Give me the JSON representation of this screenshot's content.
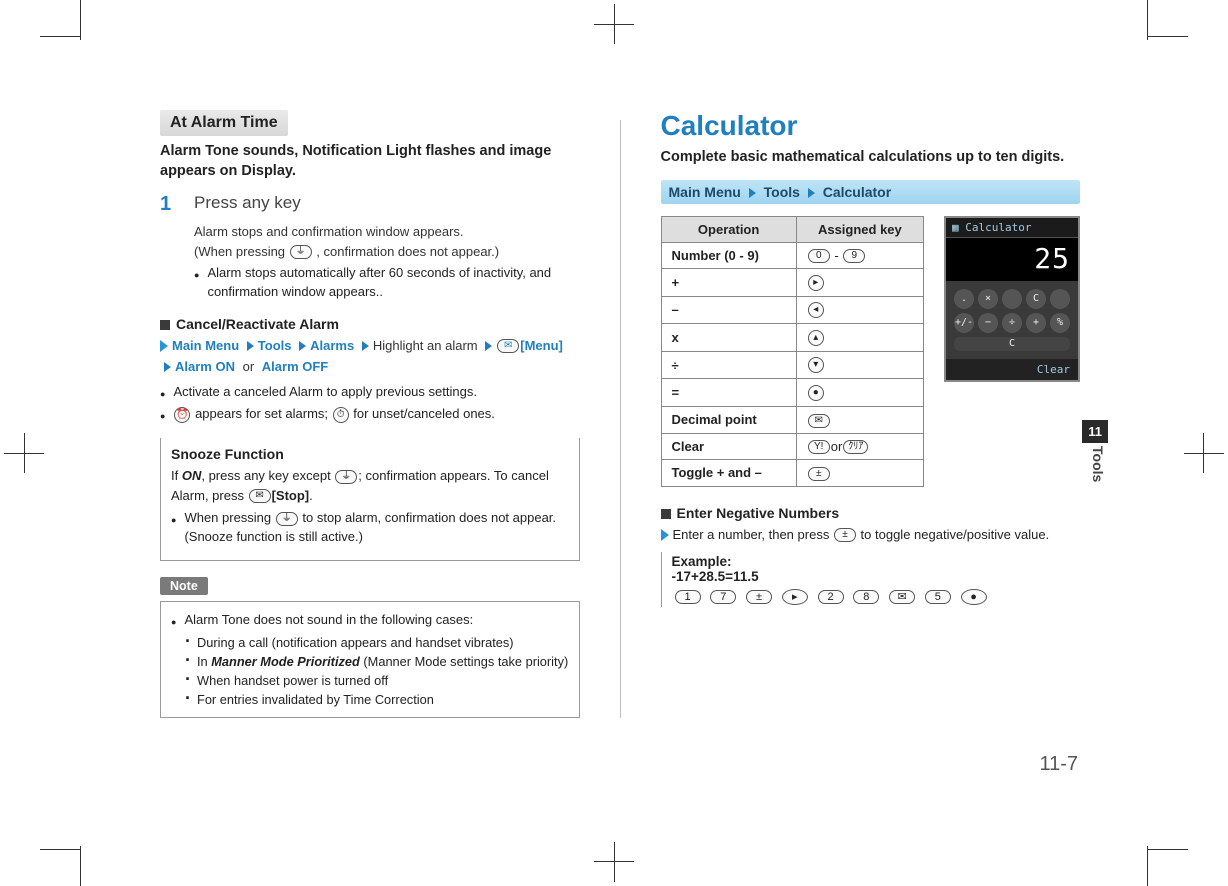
{
  "left": {
    "at_alarm_time": "At Alarm Time",
    "lead": "Alarm Tone sounds, Notification Light flashes and image appears on Display.",
    "step1_num": "1",
    "step1_title": "Press any key",
    "step1_line1": "Alarm stops and confirmation window appears.",
    "step1_line2a": "(When pressing ",
    "step1_line2b": ", confirmation does not appear.)",
    "step1_bullet": "Alarm stops automatically after 60 seconds of inactivity, and confirmation window appears..",
    "cancel_heading": "Cancel/Reactivate Alarm",
    "nav_main": "Main Menu",
    "nav_tools": "Tools",
    "nav_alarms": "Alarms",
    "nav_highlight": "Highlight an alarm",
    "nav_menu": "[Menu]",
    "nav_alarm_on": "Alarm ON",
    "nav_or": "or",
    "nav_alarm_off": "Alarm OFF",
    "cancel_b1": "Activate a canceled Alarm to apply previous settings.",
    "cancel_b2a": "appears for set alarms; ",
    "cancel_b2b": " for unset/canceled ones.",
    "snooze_title": "Snooze Function",
    "snooze_line_a": "If ",
    "snooze_on": "ON",
    "snooze_line_b": ", press any key except ",
    "snooze_line_c": "; confirmation appears. To cancel Alarm, press ",
    "snooze_stop": "[Stop]",
    "snooze_period": ".",
    "snooze_bullet_a": "When pressing ",
    "snooze_bullet_b": " to stop alarm, confirmation does not appear. (Snooze function is still active.)",
    "note_label": "Note",
    "note_intro": "Alarm Tone does not sound in the following cases:",
    "note_i1": "During a call (notification appears and handset vibrates)",
    "note_i2a": "In ",
    "note_i2b": "Manner Mode Prioritized",
    "note_i2c": " (Manner Mode settings take priority)",
    "note_i3": "When handset power is turned off",
    "note_i4": "For entries invalidated by Time Correction"
  },
  "right": {
    "h1": "Calculator",
    "lead": "Complete basic mathematical calculations up to ten digits.",
    "bc_main": "Main Menu",
    "bc_tools": "Tools",
    "bc_calc": "Calculator",
    "th_op": "Operation",
    "th_key": "Assigned key",
    "rows": {
      "r1_op": "Number (0 - 9)",
      "r1_key_a": "0",
      "r1_key_sep": " - ",
      "r1_key_b": "9",
      "r2_op": "+",
      "r3_op": "–",
      "r4_op": "x",
      "r5_op": "÷",
      "r6_op": "=",
      "r7_op": "Decimal point",
      "r8_op": "Clear",
      "r8_or": "or",
      "r9_op": "Toggle + and –"
    },
    "calc_title": "Calculator",
    "calc_display": "25",
    "calc_soft": "Clear",
    "neg_heading": "Enter Negative Numbers",
    "neg_text_a": "Enter a number, then press ",
    "neg_text_b": " to toggle negative/positive value.",
    "ex_label": "Example:",
    "ex_eq": "-17+28.5=11.5",
    "seq": {
      "k1": "1",
      "k2": "7",
      "k4": "2",
      "k5": "8",
      "k6": "5"
    }
  },
  "side": {
    "chapter": "11",
    "label": "Tools"
  },
  "page": "11-7"
}
